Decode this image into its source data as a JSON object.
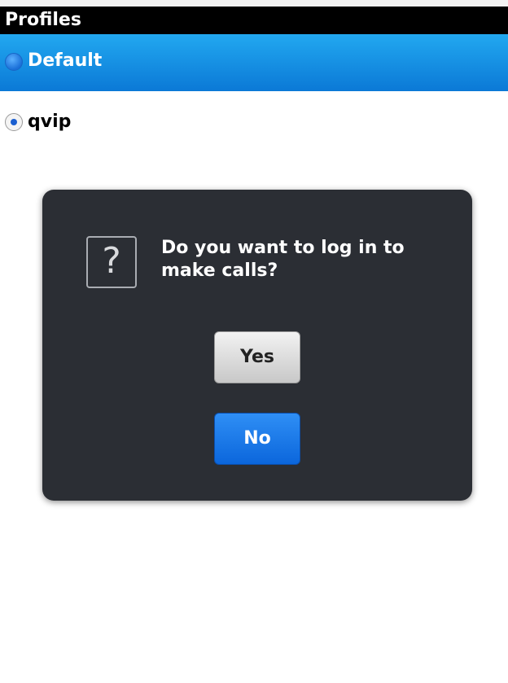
{
  "header": {
    "title": "Profiles"
  },
  "profiles": [
    {
      "label": "Default",
      "selected_row": true,
      "radio_checked": false
    },
    {
      "label": "qvip",
      "selected_row": false,
      "radio_checked": true
    }
  ],
  "dialog": {
    "icon": "question-mark-icon",
    "icon_glyph": "?",
    "message": "Do you want to log in to make calls?",
    "yes_label": "Yes",
    "no_label": "No"
  },
  "colors": {
    "title_bar": "#000000",
    "selection": "#0b79d6",
    "dialog_bg": "#2b2e34",
    "primary_button": "#0b66dc"
  }
}
